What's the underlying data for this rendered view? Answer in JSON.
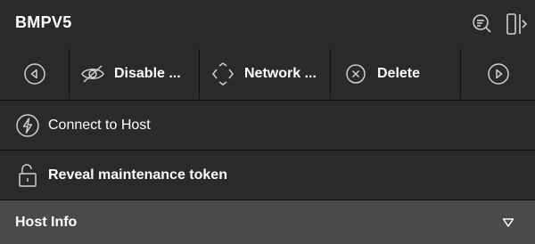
{
  "header": {
    "title": "BMPV5",
    "icons": {
      "search": "search-list-icon",
      "panel_toggle": "panel-toggle-icon"
    }
  },
  "toolbar": {
    "prev_icon": "chevron-left-circle-icon",
    "disable_label": "Disable ...",
    "disable_icon": "eye-off-icon",
    "network_label": "Network ...",
    "network_icon": "network-diamond-icon",
    "delete_label": "Delete",
    "delete_icon": "close-circle-icon",
    "next_icon": "chevron-right-circle-icon"
  },
  "actions": {
    "connect_label": "Connect to Host",
    "connect_icon": "lightning-circle-icon",
    "reveal_label": "Reveal maintenance token",
    "reveal_icon": "unlocked-padlock-icon"
  },
  "section": {
    "host_info_label": "Host Info",
    "expanded": false
  },
  "colors": {
    "panel_bg": "#2a2a2a",
    "section_bg": "#4a4a4a",
    "divider": "#111111",
    "text": "#ffffff",
    "icon_stroke": "#cfcfcf"
  }
}
